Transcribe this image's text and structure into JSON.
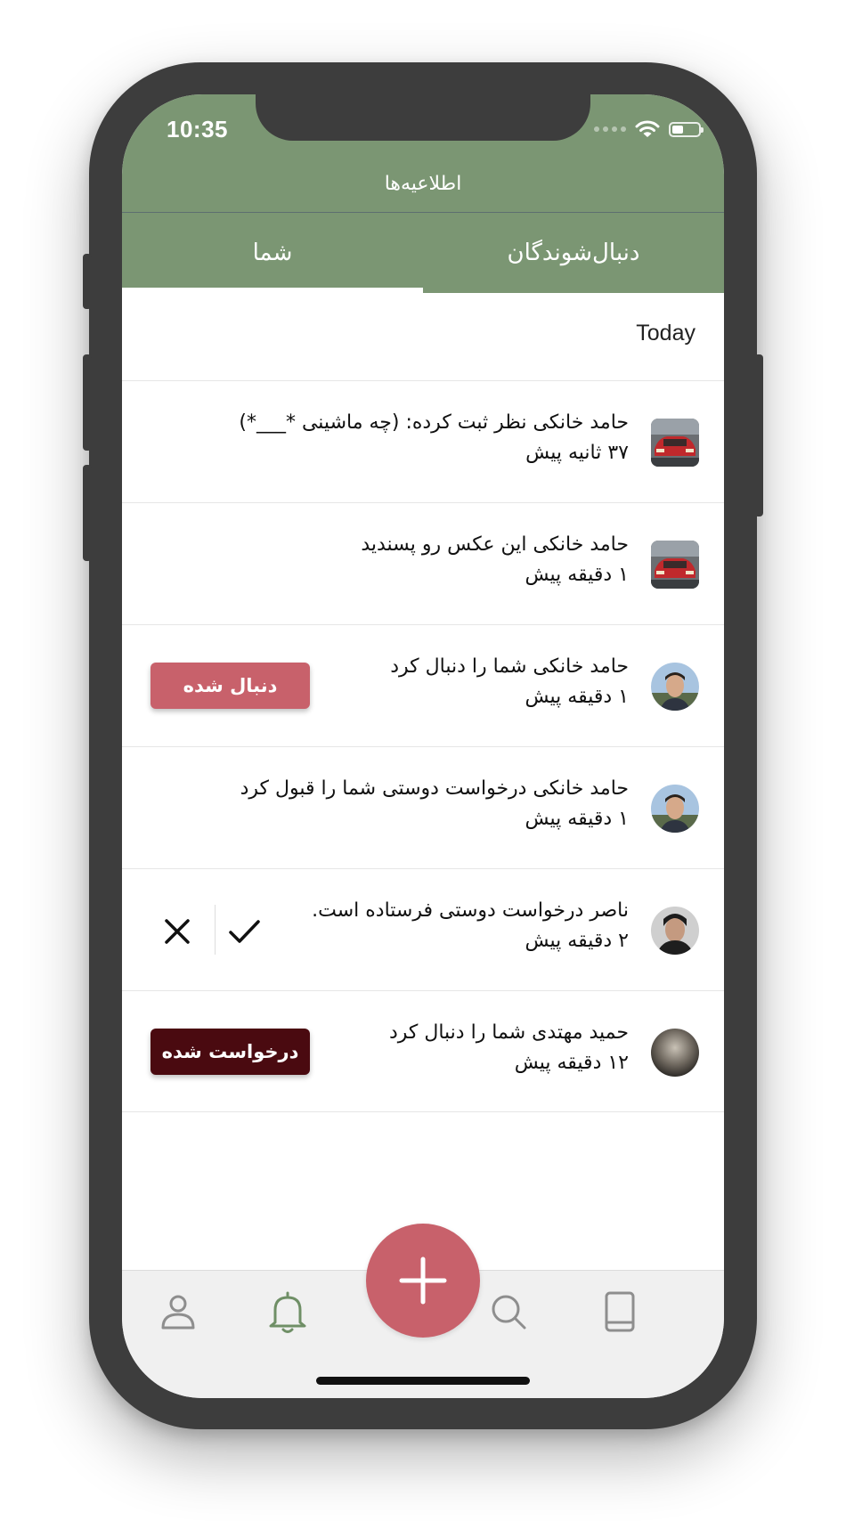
{
  "status_bar": {
    "time": "10:35",
    "icons": [
      "cellular-signal-icon",
      "wifi-icon",
      "battery-icon"
    ]
  },
  "header": {
    "title": "اطلاعیه‌ها",
    "tabs": [
      {
        "label": "شما",
        "selected": true
      },
      {
        "label": "دنبال‌شوندگان",
        "selected": false
      }
    ]
  },
  "section": {
    "label": "Today"
  },
  "notifications": [
    {
      "avatar": "car-thumbnail",
      "text": "حامد خانکی نظر ثبت کرده: (چه ماشینی *___*)",
      "time": "۳۷ ثانیه پیش"
    },
    {
      "avatar": "car-thumbnail",
      "text": "حامد خانکی این عکس رو پسندید",
      "time": "۱ دقیقه پیش"
    },
    {
      "avatar": "user-photo",
      "text": "حامد خانکی شما را دنبال کرد",
      "time": "۱ دقیقه پیش",
      "button": "دنبال شده"
    },
    {
      "avatar": "user-photo",
      "text": "حامد خانکی درخواست دوستی شما را قبول کرد",
      "time": "۱ دقیقه پیش"
    },
    {
      "avatar": "user-photo",
      "text": "ناصر درخواست دوستی فرستاده است.",
      "time": "۲ دقیقه پیش",
      "actions": [
        "accept-check-icon",
        "reject-x-icon"
      ]
    },
    {
      "avatar": "user-photo",
      "text": "حمید مهتدی شما را دنبال کرد",
      "time": "۱۲ دقیقه پیش",
      "button": "درخواست شده"
    }
  ],
  "bottom_nav": {
    "items": [
      "profile-icon",
      "bell-icon",
      "add-button",
      "search-icon",
      "book-icon"
    ],
    "active": "bell-icon"
  },
  "colors": {
    "header": "#7b9673",
    "accent_pink": "#c8616b",
    "dark_button": "#4a0a10",
    "active_icon": "#6f8f66",
    "inactive_icon": "#8e8e8e"
  }
}
